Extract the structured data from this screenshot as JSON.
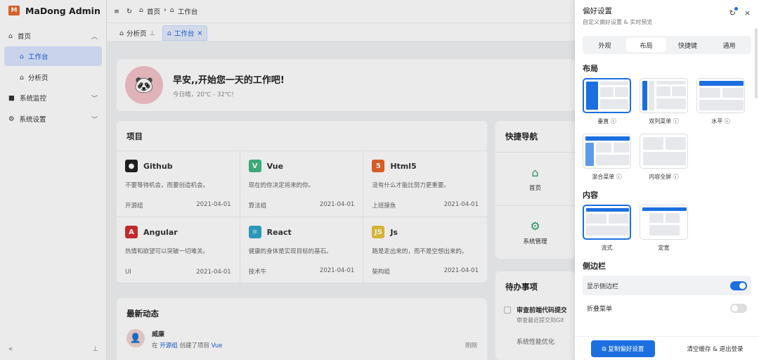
{
  "app": {
    "title": "MaDong Admin",
    "logo": "M"
  },
  "sidebar": {
    "items": [
      {
        "label": "首页"
      },
      {
        "label": "工作台"
      },
      {
        "label": "分析页"
      },
      {
        "label": "系统监控"
      },
      {
        "label": "系统设置"
      }
    ]
  },
  "breadcrumb": [
    "首页",
    "工作台"
  ],
  "tabs": [
    {
      "label": "分析页"
    },
    {
      "label": "工作台"
    }
  ],
  "welcome": {
    "title": "早安,,开始您一天的工作吧!",
    "sub": "今日晴，20℃ - 32℃!"
  },
  "projects": {
    "title": "项目",
    "items": [
      {
        "name": "Github",
        "desc": "不要等待机会，而要创造机会。",
        "group": "开源组",
        "date": "2021-04-01",
        "color": "#222",
        "icon": "github-icon"
      },
      {
        "name": "Vue",
        "desc": "现在的你决定将来的你。",
        "group": "算法组",
        "date": "2021-04-01",
        "color": "#41b883",
        "icon": "vue-icon"
      },
      {
        "name": "Html5",
        "desc": "没有什么才能比努力更重要。",
        "group": "上班摸鱼",
        "date": "2021-04-01",
        "color": "#e8642a",
        "icon": "html5-icon"
      },
      {
        "name": "Angular",
        "desc": "热情和欲望可以突破一切难关。",
        "group": "UI",
        "date": "2021-04-01",
        "color": "#d32f2f",
        "icon": "angular-icon"
      },
      {
        "name": "React",
        "desc": "健康的身体是实现目标的基石。",
        "group": "技术牛",
        "date": "2021-04-01",
        "color": "#2fa5c9",
        "icon": "react-icon"
      },
      {
        "name": "Js",
        "desc": "路是走出来的，而不是空想出来的。",
        "group": "架构组",
        "date": "2021-04-01",
        "color": "#e8c43a",
        "icon": "js-icon"
      }
    ]
  },
  "news": {
    "title": "最新动态",
    "user": "威廉",
    "prefix": "在",
    "group": "开源组",
    "middle": "创建了项目",
    "project": "Vue",
    "time": "刚刚"
  },
  "quick": {
    "title": "快捷导航",
    "items": [
      "首页",
      "系统管理"
    ]
  },
  "todo": {
    "title": "待办事项",
    "items": [
      {
        "title": "审查前端代码提交",
        "desc": "审查最近提交到Git"
      },
      {
        "title": "系统性能优化",
        "desc": ""
      }
    ]
  },
  "prefs": {
    "title": "偏好设置",
    "subtitle": "自定义偏好设置 & 实时预览",
    "tabs": [
      "外观",
      "布局",
      "快捷键",
      "通用"
    ],
    "layout_title": "布局",
    "layouts": [
      "垂直",
      "双列菜单",
      "水平",
      "混合菜单",
      "内容全屏"
    ],
    "content_title": "内容",
    "contents": [
      "流式",
      "定宽"
    ],
    "sidebar_title": "侧边栏",
    "show_sidebar": "显示侧边栏",
    "collapse_menu": "折叠菜单",
    "copy_btn": "复制偏好设置",
    "clear_btn": "清空缓存 & 退出登录"
  }
}
